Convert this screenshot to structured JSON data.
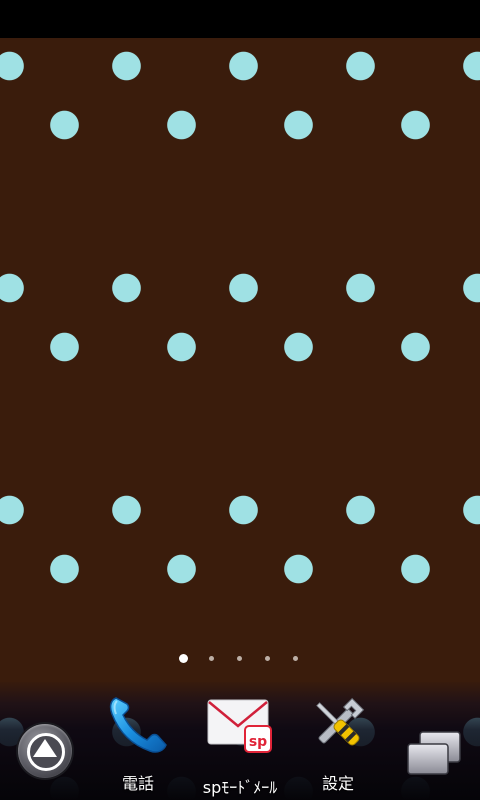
{
  "screen": {
    "wallpaper": {
      "background_color": "#3a1c0c",
      "dot_color": "#9fe1e4",
      "pattern": "polka-dot"
    },
    "page_indicator": {
      "total_pages": 5,
      "current_page": 1
    },
    "dock": {
      "apps_button_icon": "apps-launcher-icon",
      "items": [
        {
          "label": "電話",
          "icon": "phone-icon"
        },
        {
          "label": "spﾓｰﾄﾞﾒｰﾙ",
          "icon": "sp-mode-mail-icon"
        },
        {
          "label": "設定",
          "icon": "settings-tools-icon"
        }
      ],
      "recent_apps_icon": "recent-apps-icon"
    }
  }
}
